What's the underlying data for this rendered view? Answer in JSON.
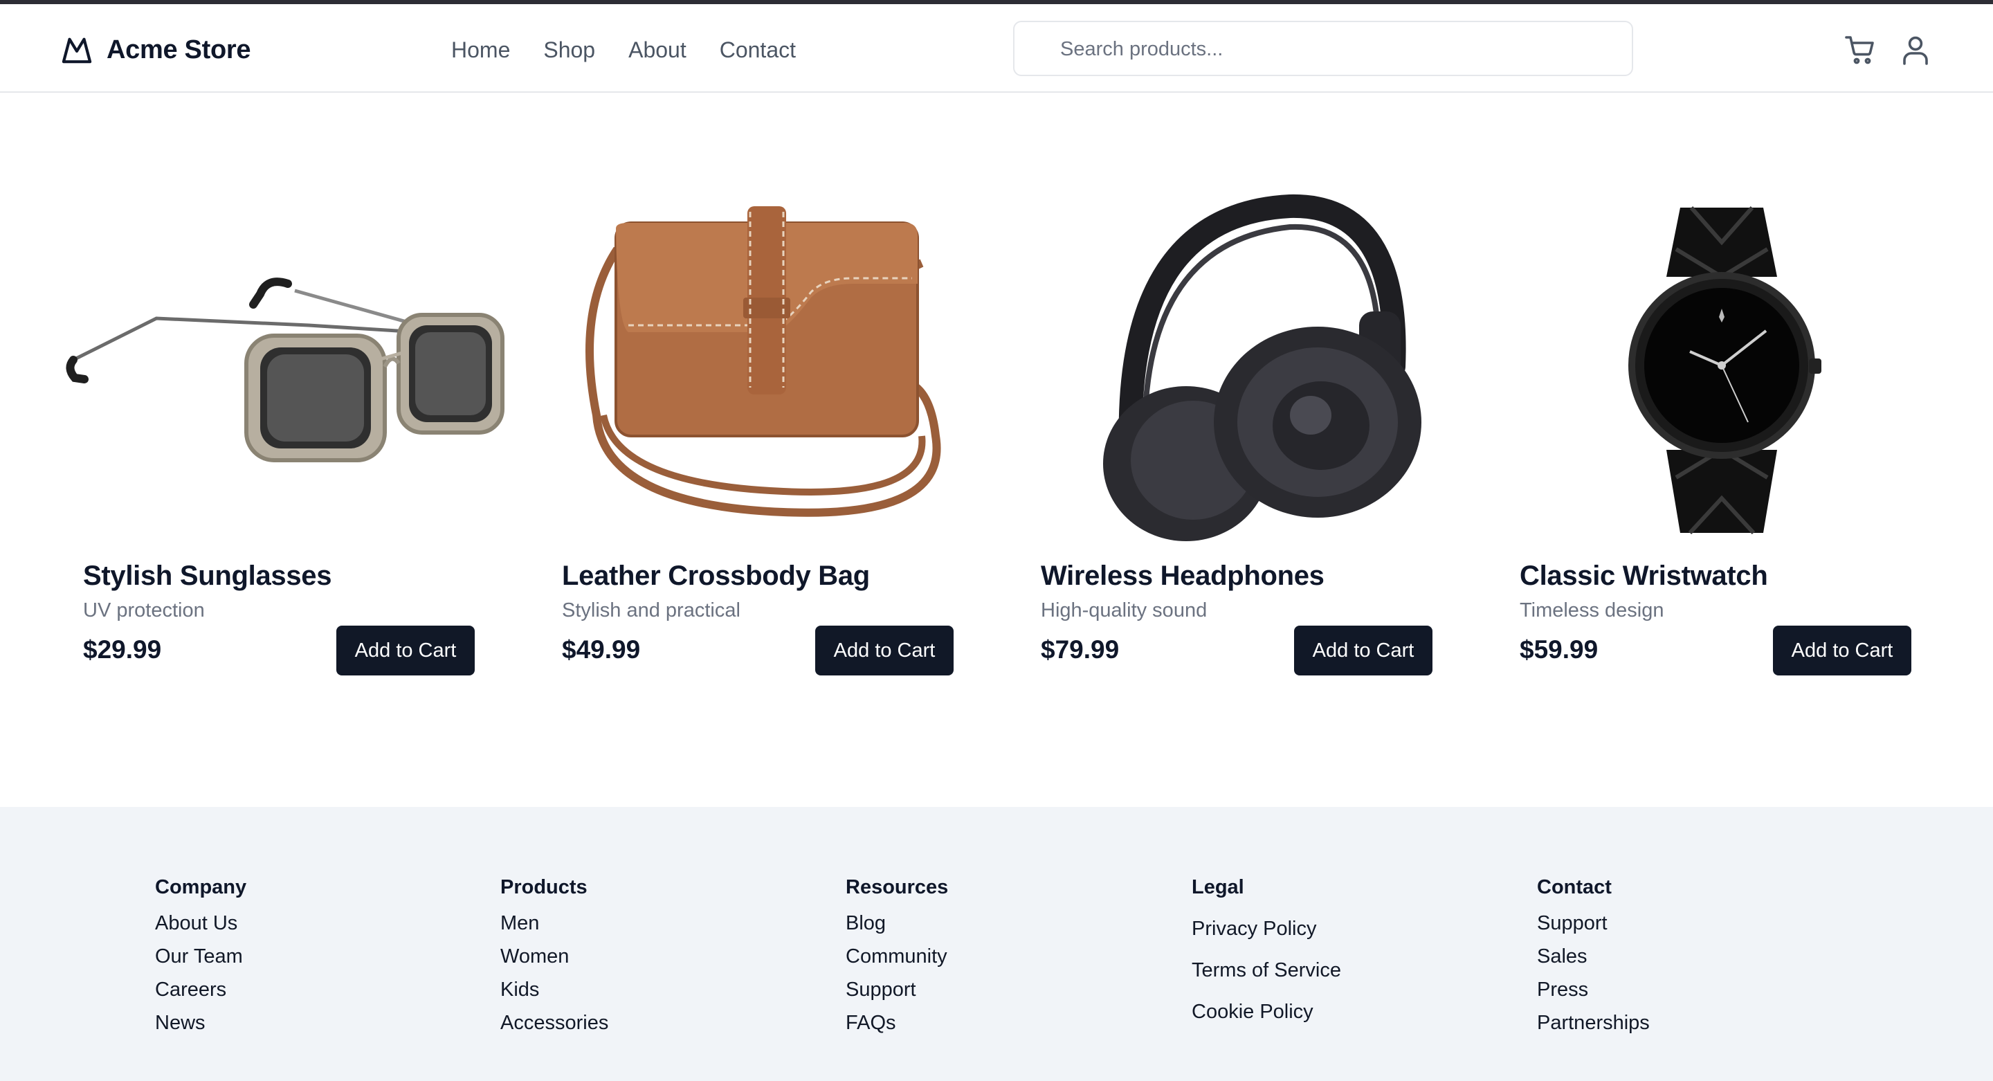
{
  "header": {
    "brand": "Acme Store",
    "nav": [
      "Home",
      "Shop",
      "About",
      "Contact"
    ],
    "search_placeholder": "Search products...",
    "icons": [
      "mountain-logo-icon",
      "cart-icon",
      "user-icon"
    ]
  },
  "products": [
    {
      "title": "Stylish Sunglasses",
      "description": "UV protection",
      "price": "$29.99",
      "button": "Add to Cart",
      "image": "sunglasses"
    },
    {
      "title": "Leather Crossbody Bag",
      "description": "Stylish and practical",
      "price": "$49.99",
      "button": "Add to Cart",
      "image": "leather-bag"
    },
    {
      "title": "Wireless Headphones",
      "description": "High-quality sound",
      "price": "$79.99",
      "button": "Add to Cart",
      "image": "headphones"
    },
    {
      "title": "Classic Wristwatch",
      "description": "Timeless design",
      "price": "$59.99",
      "button": "Add to Cart",
      "image": "wristwatch"
    }
  ],
  "footer": {
    "columns": [
      {
        "heading": "Company",
        "links": [
          "About Us",
          "Our Team",
          "Careers",
          "News"
        ]
      },
      {
        "heading": "Products",
        "links": [
          "Men",
          "Women",
          "Kids",
          "Accessories"
        ]
      },
      {
        "heading": "Resources",
        "links": [
          "Blog",
          "Community",
          "Support",
          "FAQs"
        ]
      },
      {
        "heading": "Legal",
        "links": [
          "Privacy Policy",
          "Terms of Service",
          "Cookie Policy"
        ]
      },
      {
        "heading": "Contact",
        "links": [
          "Support",
          "Sales",
          "Press",
          "Partnerships"
        ]
      }
    ]
  },
  "colors": {
    "primary_button": "#111827",
    "footer_bg": "#f1f4f8",
    "muted_text": "#6b7280"
  }
}
